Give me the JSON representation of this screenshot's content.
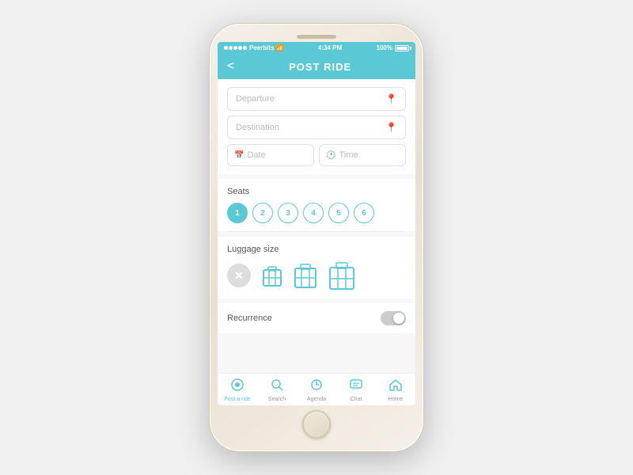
{
  "statusBar": {
    "carrier": "Peerbits",
    "signal": "wifi",
    "time": "4:34 PM",
    "battery": "100%"
  },
  "header": {
    "back_label": "<",
    "title": "POST RIDE"
  },
  "form": {
    "departure_placeholder": "Departure",
    "destination_placeholder": "Destination",
    "date_placeholder": "Date",
    "time_placeholder": "Time"
  },
  "seats": {
    "label": "Seats",
    "options": [
      "1",
      "2",
      "3",
      "4",
      "5",
      "6"
    ],
    "selected": 0
  },
  "luggage": {
    "label": "Luggage size",
    "options": [
      "none",
      "small",
      "medium",
      "large"
    ]
  },
  "recurrence": {
    "label": "Recurrence",
    "enabled": false
  },
  "bottomNav": {
    "items": [
      {
        "label": "Post a ride",
        "icon": "🛡"
      },
      {
        "label": "Search",
        "icon": "🔍"
      },
      {
        "label": "Agenda",
        "icon": "🔔"
      },
      {
        "label": "Chat",
        "icon": "💬"
      },
      {
        "label": "Home",
        "icon": "🏠"
      }
    ]
  }
}
